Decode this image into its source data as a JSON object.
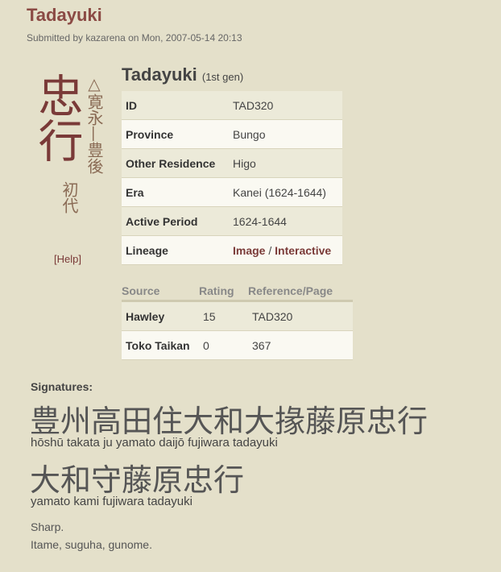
{
  "node": {
    "title": "Tadayuki",
    "submitted": "Submitted by kazarena on Mon, 2007-05-14 20:13"
  },
  "kanji": {
    "main": "忠行",
    "side": "△寛永—豊後",
    "generation": "初代",
    "help": "[Help]"
  },
  "smith": {
    "name": "Tadayuki",
    "generation": "(1st gen)"
  },
  "info": {
    "rows": [
      {
        "label": "ID",
        "value": "TAD320"
      },
      {
        "label": "Province",
        "value": "Bungo"
      },
      {
        "label": "Other Residence",
        "value": "Higo"
      },
      {
        "label": "Era",
        "value": "Kanei (1624-1644)"
      },
      {
        "label": "Active Period",
        "value": "1624-1644"
      }
    ],
    "lineage_label": "Lineage",
    "lineage_image": "Image",
    "lineage_sep": " / ",
    "lineage_interactive": "Interactive"
  },
  "ratings": {
    "headers": [
      "Source",
      "Rating",
      "Reference/Page"
    ],
    "rows": [
      {
        "source": "Hawley",
        "rating": "15",
        "ref": "TAD320"
      },
      {
        "source": "Toko Taikan",
        "rating": "0",
        "ref": "367"
      }
    ]
  },
  "signatures": {
    "label": "Signatures:",
    "items": [
      {
        "kanji": "豊州高田住大和大掾藤原忠行",
        "romaji": "hōshū takata ju yamato daijō fujiwara tadayuki"
      },
      {
        "kanji": "大和守藤原忠行",
        "romaji": "yamato kami fujiwara tadayuki"
      }
    ]
  },
  "notes": [
    "Sharp.",
    "Itame, suguha, gunome."
  ]
}
